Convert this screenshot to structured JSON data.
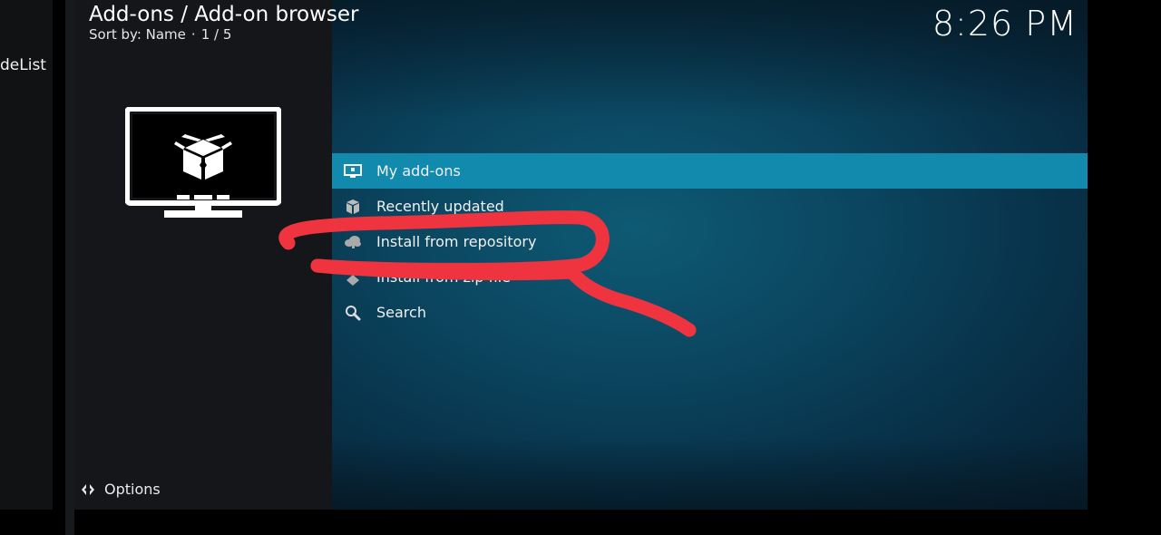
{
  "left_strip": {
    "label": "deList"
  },
  "header": {
    "title": "Add-ons / Add-on browser",
    "sort_label": "Sort by: Name",
    "separator": "·",
    "page": "1 / 5"
  },
  "clock": "8:26 PM",
  "menu": {
    "items": [
      {
        "label": "My add-ons",
        "icon": "monitor-icon",
        "selected": true
      },
      {
        "label": "Recently updated",
        "icon": "box-icon",
        "selected": false
      },
      {
        "label": "Install from repository",
        "icon": "cloud-box-icon",
        "selected": false
      },
      {
        "label": "Install from zip file",
        "icon": "zip-icon",
        "selected": false
      },
      {
        "label": "Search",
        "icon": "search-icon",
        "selected": false
      }
    ]
  },
  "options": {
    "label": "Options",
    "icon": "options-icon"
  },
  "colors": {
    "selected_bg": "#128aae",
    "side_panel": "#151619",
    "annotation": "#f0343f"
  }
}
